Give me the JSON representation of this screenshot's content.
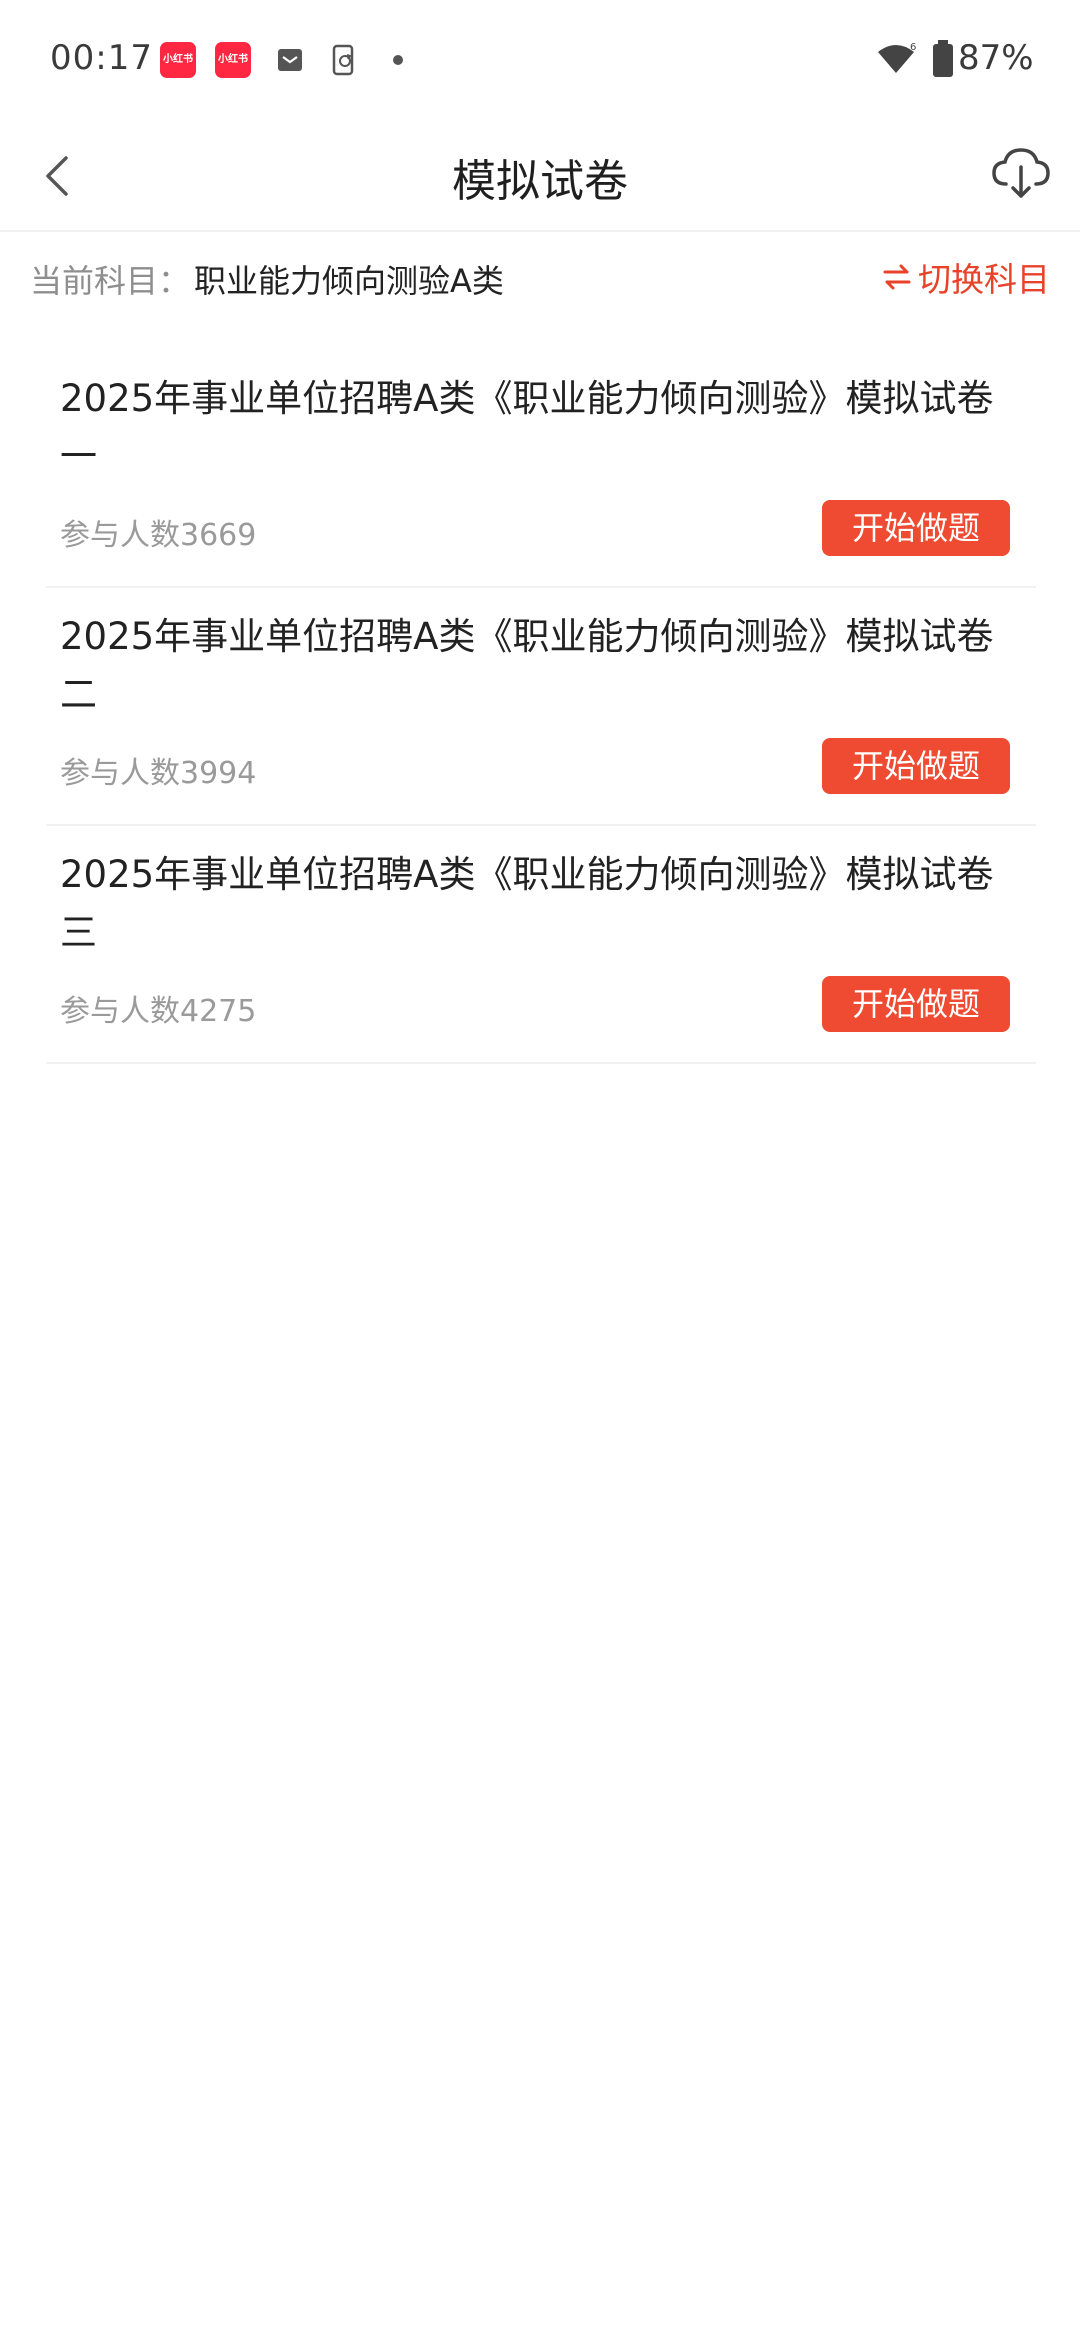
{
  "status_bar": {
    "time": "00:17",
    "notif_app_1": "小红书",
    "notif_app_2": "小红书",
    "battery": "87%",
    "icons": [
      "xiaohongshu-app-icon",
      "xiaohongshu-app-icon",
      "mail-icon",
      "phone-sync-icon",
      "wifi-icon",
      "battery-icon"
    ]
  },
  "header": {
    "title": "模拟试卷",
    "back_icon": "chevron-left-icon",
    "download_icon": "cloud-download-icon"
  },
  "subject": {
    "label": "当前科目：",
    "value": "职业能力倾向测验A类",
    "switch_label": "切换科目",
    "switch_icon": "swap-arrows-icon"
  },
  "papers": [
    {
      "title": "2025年事业单位招聘A类《职业能力倾向测验》模拟试卷一",
      "count": "参与人数3669",
      "button": "开始做题"
    },
    {
      "title": "2025年事业单位招聘A类《职业能力倾向测验》模拟试卷二",
      "count": "参与人数3994",
      "button": "开始做题"
    },
    {
      "title": "2025年事业单位招聘A类《职业能力倾向测验》模拟试卷三",
      "count": "参与人数4275",
      "button": "开始做题"
    }
  ],
  "colors": {
    "accent": "#ef4a32",
    "switch_text": "#e8432a",
    "muted_text": "#9a9a9a"
  }
}
